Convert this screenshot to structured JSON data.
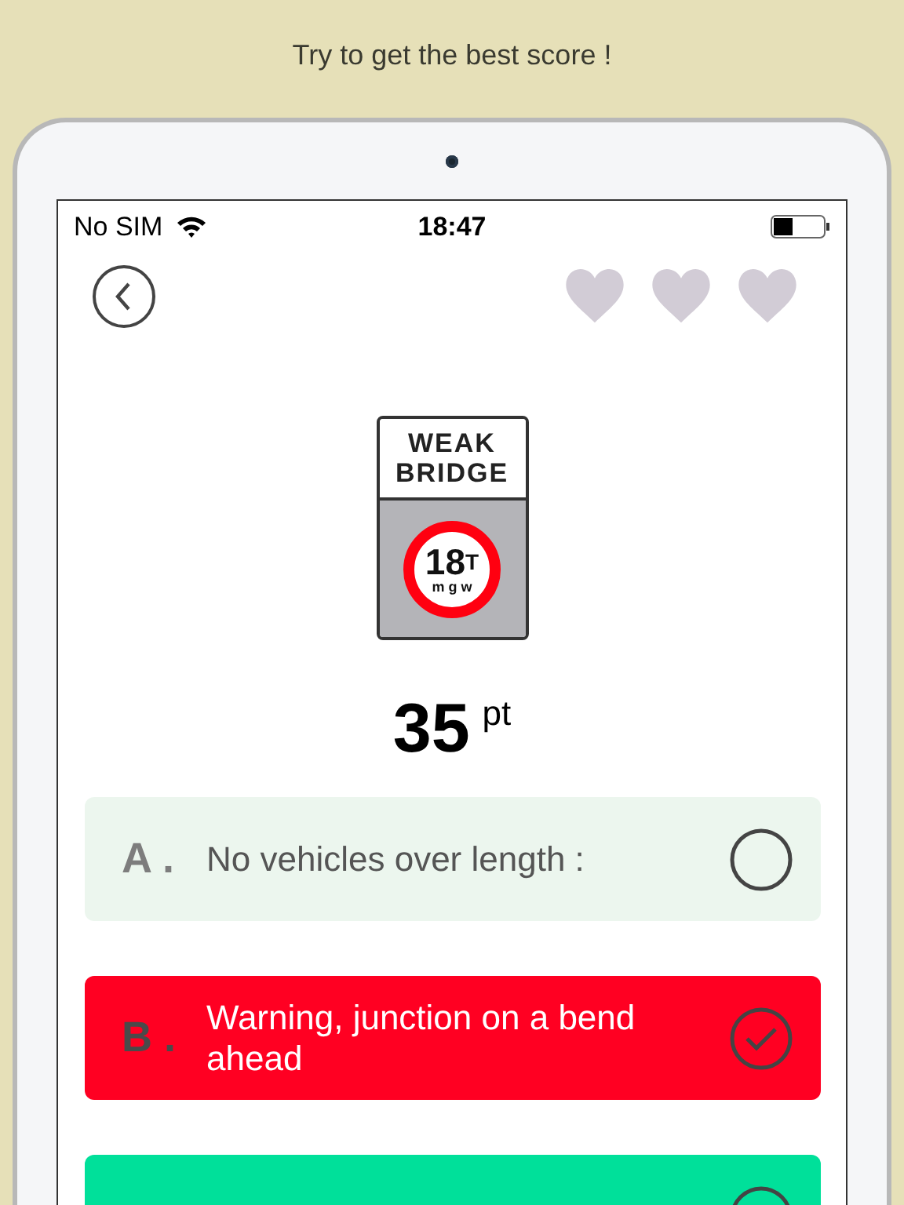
{
  "caption": "Try to get the best score !",
  "status_bar": {
    "carrier": "No SIM",
    "time": "18:47"
  },
  "sign": {
    "lines": [
      "WEAK",
      "BRIDGE"
    ],
    "limit": "18",
    "unit": "T",
    "sub": "m g w"
  },
  "score": {
    "value": "35",
    "unit": "pt"
  },
  "options": [
    {
      "letter": "A .",
      "text": "No vehicles over length :",
      "color": "#ecf6ee",
      "selected": false
    },
    {
      "letter": "B .",
      "text": "Warning, junction on a bend ahead",
      "color": "#ff0022",
      "selected": true
    },
    {
      "color": "#00e09a"
    }
  ]
}
